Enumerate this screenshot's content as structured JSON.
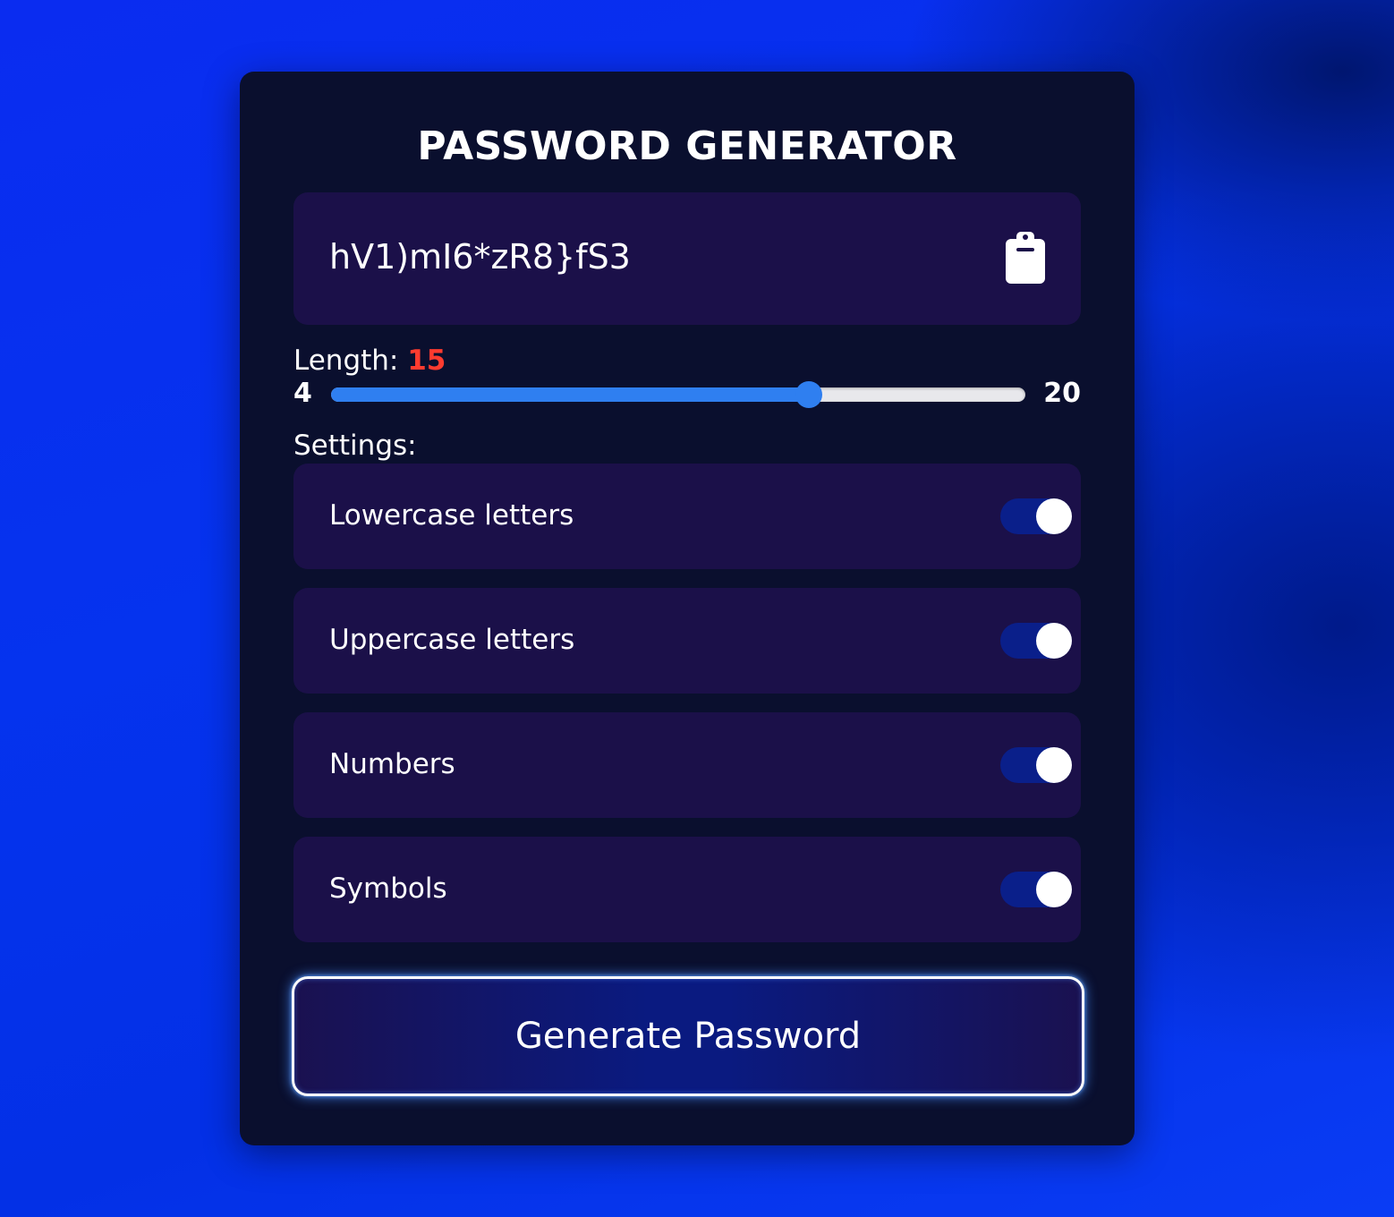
{
  "app": {
    "title": "PASSWORD GENERATOR"
  },
  "password": {
    "value": "hV1)mI6*zR8}fS3",
    "copy_icon": "clipboard-icon"
  },
  "length": {
    "label": "Length: ",
    "value": "15",
    "min": "4",
    "max": "20",
    "fraction": 0.6875
  },
  "settings": {
    "label": "Settings:",
    "items": [
      {
        "label": "Lowercase letters",
        "enabled": true
      },
      {
        "label": "Uppercase letters",
        "enabled": true
      },
      {
        "label": "Numbers",
        "enabled": true
      },
      {
        "label": "Symbols",
        "enabled": true
      }
    ]
  },
  "generate_button": {
    "label": "Generate Password"
  },
  "colors": {
    "accent": "#2f7ff0",
    "length_value": "#ff3b2f",
    "toggle_on": "#0a1f8a",
    "panel": "#1b1049",
    "card": "#0a0f2e"
  }
}
